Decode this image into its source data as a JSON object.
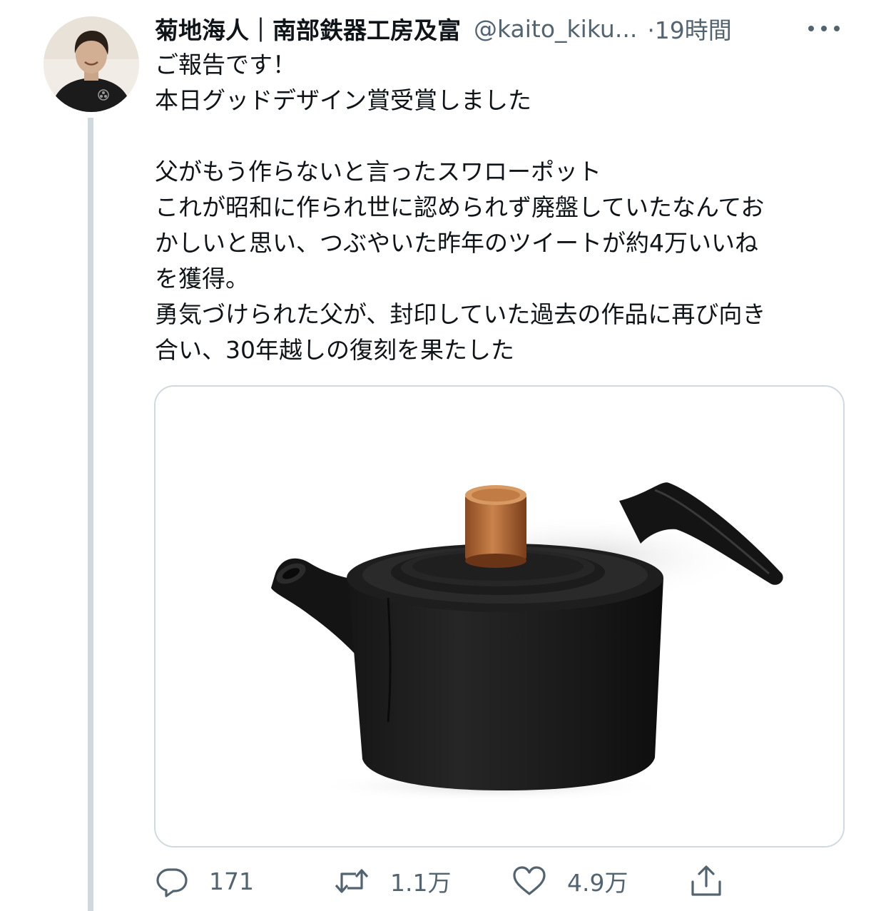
{
  "tweet": {
    "author": {
      "display_name": "菊地海人｜南部鉄器工房及富",
      "handle": "@kaito_kiku...",
      "avatar_icon": "avatar"
    },
    "time": "·19時間",
    "more_icon": "more-icon",
    "text_lines": [
      "ご報告です！",
      "本日グッドデザイン賞受賞しました",
      "",
      "父がもう作らないと言ったスワローポット",
      "これが昭和に作られ世に認められず廃盤していたなんてお",
      "かしいと思い、つぶやいた昨年のツイートが約4万いいね",
      "を獲得。",
      "勇気づけられた父が、封印していた過去の作品に再び向き",
      "合い、30年越しの復刻を果たした"
    ],
    "actions": {
      "reply": {
        "icon": "reply-icon",
        "count": "171"
      },
      "retweet": {
        "icon": "retweet-icon",
        "count": "1.1万"
      },
      "like": {
        "icon": "heart-icon",
        "count": "4.9万"
      },
      "share": {
        "icon": "share-icon"
      }
    }
  },
  "colors": {
    "text_primary": "#0f1419",
    "text_secondary": "#536471",
    "border": "#cfd9de"
  }
}
